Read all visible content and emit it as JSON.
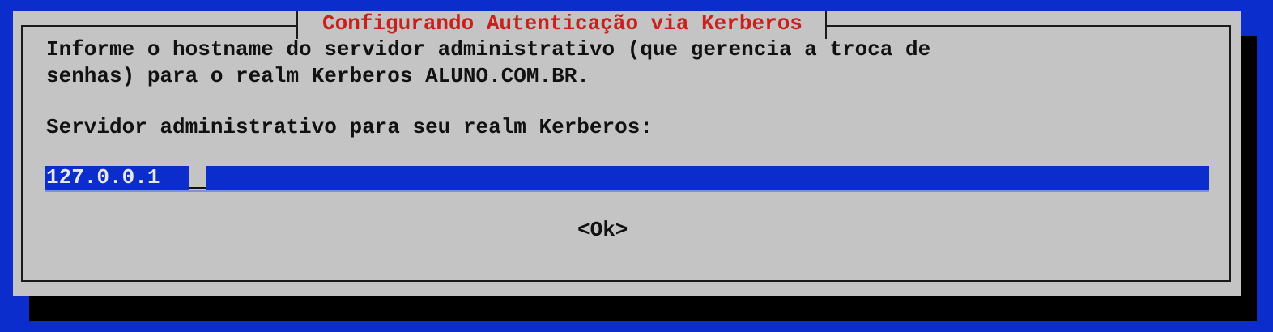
{
  "dialog": {
    "title": "Configurando Autenticação via Kerberos",
    "description_line1": "Informe o hostname do servidor administrativo (que gerencia a troca de",
    "description_line2": "senhas) para o realm Kerberos ALUNO.COM.BR.",
    "field_label": "Servidor administrativo para seu realm Kerberos:",
    "field_value": "127.0.0.1",
    "ok_button": "<Ok>"
  },
  "colors": {
    "background": "#0a2dcb",
    "dialog": "#c4c4c4",
    "title": "#c9201c"
  }
}
